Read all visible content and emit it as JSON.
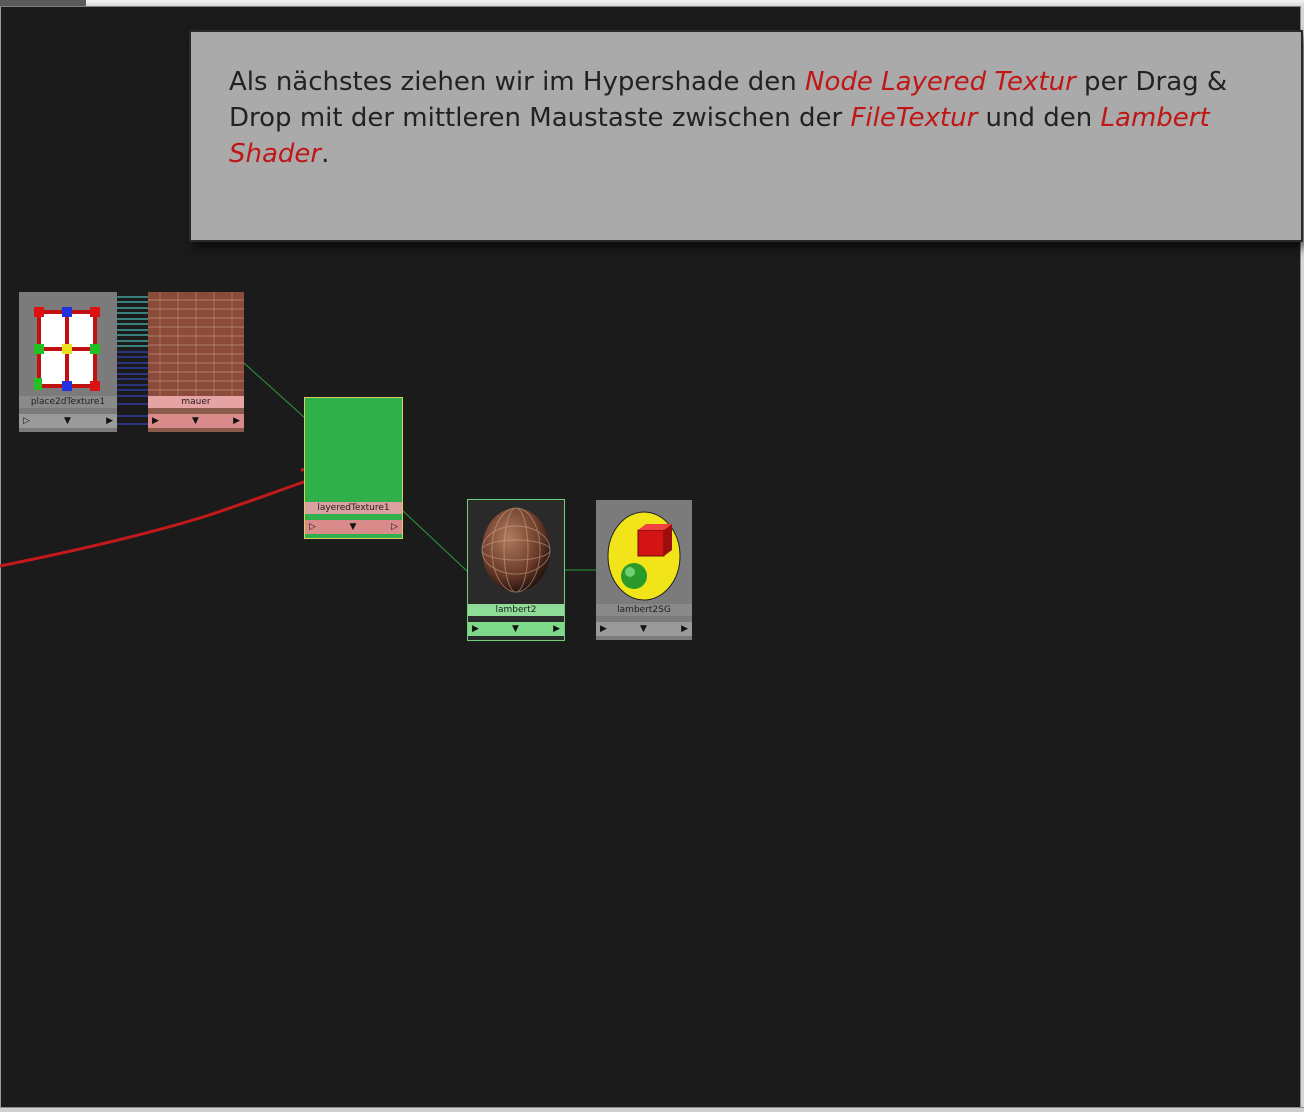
{
  "callout": {
    "t1": "Als nächstes ziehen wir im Hypershade den ",
    "h1": "Node Layered Textur",
    "t2": " per Drag & Drop mit der mittleren Maustaste zwischen der ",
    "h2": "FileTextur",
    "t3": " und den ",
    "h3": "Lambert Shader",
    "t4": "."
  },
  "nodes": {
    "place2d": {
      "label": "place2dTexture1",
      "left": "▷",
      "mid": "▼",
      "right": "▶"
    },
    "mauer": {
      "label": "mauer",
      "left": "▶",
      "mid": "▼",
      "right": "▶"
    },
    "layered": {
      "label": "layeredTexture1",
      "left": "▷",
      "mid": "▼",
      "right": "▷"
    },
    "lambert2": {
      "label": "lambert2",
      "left": "▶",
      "mid": "▼",
      "right": "▶"
    },
    "lambert2sg": {
      "label": "lambert2SG",
      "left": "▶",
      "mid": "▼",
      "right": "▶"
    }
  },
  "colors": {
    "canvas": "#1b1b1b",
    "callout_bg": "#a9aaa9",
    "highlight": "#c01616",
    "selected_node": "#2fb04a",
    "texture_ctrl": "#d98b8b",
    "shader_ctrl": "#7ed88a",
    "connection": "#2e9a3a",
    "annotation_stroke": "#c21a1a"
  }
}
